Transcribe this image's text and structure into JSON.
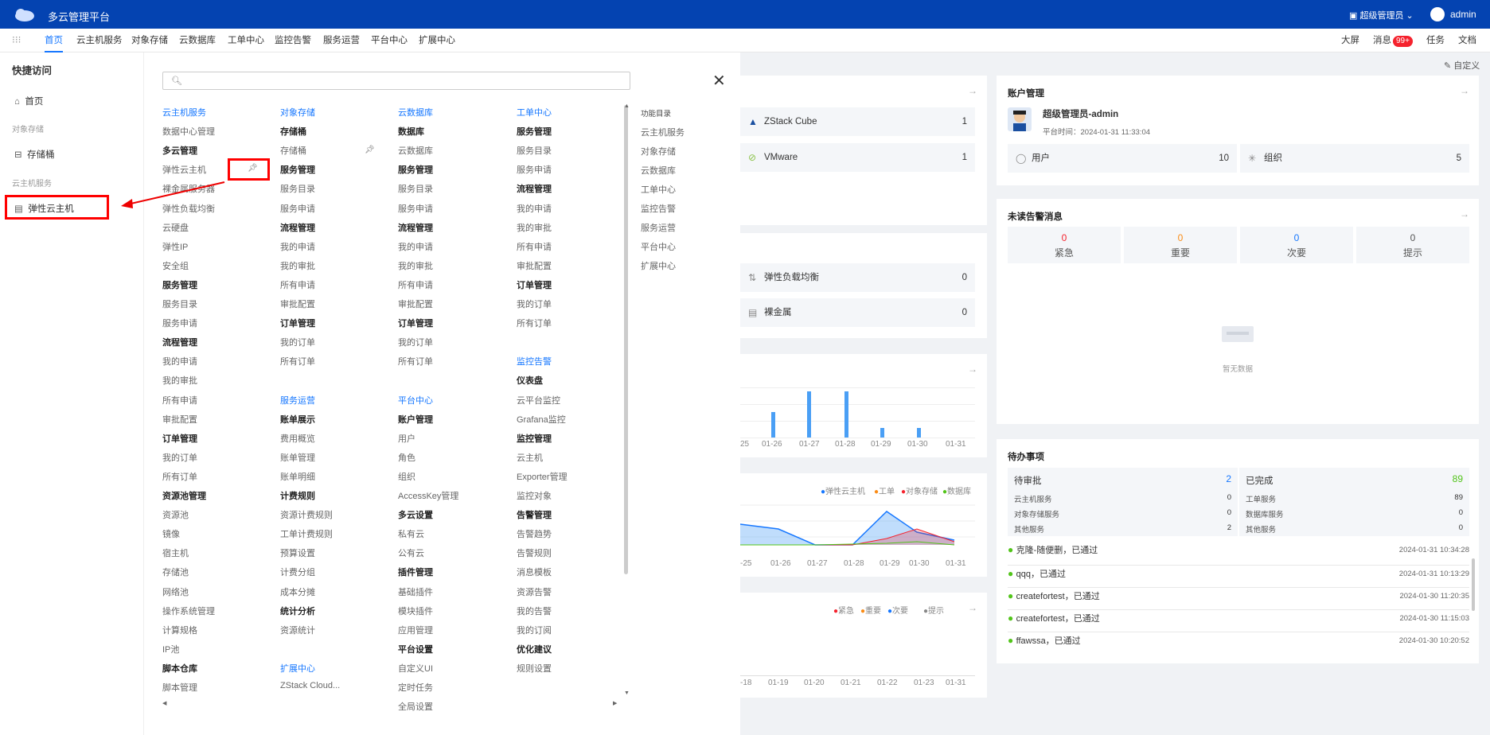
{
  "app": {
    "title": "多云管理平台",
    "role": "超级管理员",
    "user": "admin"
  },
  "nav": {
    "items": [
      "首页",
      "云主机服务",
      "对象存储",
      "云数据库",
      "工单中心",
      "监控告警",
      "服务运营",
      "平台中心",
      "扩展中心"
    ],
    "right": {
      "screen": "大屏",
      "messages": "消息",
      "msg_badge": "99+",
      "tasks": "任务",
      "docs": "文档"
    }
  },
  "customize": "自定义",
  "quick_access": {
    "title": "快捷访问",
    "items": [
      {
        "label": "首页",
        "icon": "home-icon"
      },
      {
        "group": "对象存储"
      },
      {
        "label": "存储桶",
        "icon": "bucket-icon"
      },
      {
        "group": "云主机服务"
      },
      {
        "label": "弹性云主机",
        "icon": "server-icon"
      }
    ]
  },
  "menu": {
    "search_placeholder": "",
    "col1": [
      "云主机服务",
      "数据中心管理",
      "多云管理",
      "弹性云主机",
      "裸金属服务器",
      "弹性负载均衡",
      "云硬盘",
      "弹性IP",
      "安全组",
      "服务管理",
      "服务目录",
      "服务申请",
      "流程管理",
      "我的申请",
      "我的审批",
      "所有申请",
      "审批配置",
      "订单管理",
      "我的订单",
      "所有订单",
      "资源池管理",
      "资源池",
      "镜像",
      "宿主机",
      "存储池",
      "网络池",
      "操作系统管理",
      "计算规格",
      "IP池",
      "脚本仓库",
      "脚本管理"
    ],
    "col2": [
      "对象存储",
      "存储桶",
      "存储桶",
      "服务管理",
      "服务目录",
      "服务申请",
      "流程管理",
      "我的申请",
      "我的审批",
      "所有申请",
      "审批配置",
      "订单管理",
      "我的订单",
      "所有订单",
      "",
      "服务运营",
      "账单展示",
      "费用概览",
      "账单管理",
      "账单明细",
      "计费规则",
      "资源计费规则",
      "工单计费规则",
      "预算设置",
      "计费分组",
      "成本分摊",
      "统计分析",
      "资源统计",
      "",
      "扩展中心",
      "ZStack Cloud..."
    ],
    "col3": [
      "云数据库",
      "数据库",
      "云数据库",
      "服务管理",
      "服务目录",
      "服务申请",
      "流程管理",
      "我的申请",
      "我的审批",
      "所有申请",
      "审批配置",
      "订单管理",
      "我的订单",
      "所有订单",
      "",
      "平台中心",
      "账户管理",
      "用户",
      "角色",
      "组织",
      "AccessKey管理",
      "多云设置",
      "私有云",
      "公有云",
      "插件管理",
      "基础插件",
      "模块插件",
      "应用管理",
      "平台设置",
      "自定义UI",
      "定时任务",
      "全局设置"
    ],
    "col4": [
      "工单中心",
      "服务管理",
      "服务目录",
      "服务申请",
      "流程管理",
      "我的申请",
      "我的审批",
      "所有申请",
      "审批配置",
      "订单管理",
      "我的订单",
      "所有订单",
      "",
      "监控告警",
      "仪表盘",
      "云平台监控",
      "Grafana监控",
      "监控管理",
      "云主机",
      "Exporter管理",
      "监控对象",
      "告警管理",
      "告警趋势",
      "告警规则",
      "消息模板",
      "资源告警",
      "我的告警",
      "我的订阅",
      "优化建议",
      "规则设置"
    ],
    "directory_title": "功能目录",
    "directory": [
      "云主机服务",
      "对象存储",
      "云数据库",
      "工单中心",
      "监控告警",
      "服务运营",
      "平台中心",
      "扩展中心"
    ]
  },
  "dashboard": {
    "platforms": [
      {
        "name": "ZStack Cube",
        "count": "1"
      },
      {
        "name": "VMware",
        "count": "1"
      }
    ],
    "resources": [
      {
        "name": "弹性负载均衡",
        "count": "0"
      },
      {
        "name": "裸金属",
        "count": "0"
      }
    ],
    "bar_chart": {
      "ticks": [
        "25",
        "01-26",
        "01-27",
        "01-28",
        "01-29",
        "01-30",
        "01-31"
      ]
    },
    "line_chart": {
      "legend": [
        "弹性云主机",
        "工单",
        "对象存储",
        "数据库"
      ],
      "ticks": [
        "-25",
        "01-26",
        "01-27",
        "01-28",
        "01-29",
        "01-30",
        "01-31"
      ]
    },
    "alert_chart": {
      "legend": [
        "紧急",
        "重要",
        "次要",
        "提示"
      ],
      "ticks": [
        "-18",
        "01-19",
        "01-20",
        "01-21",
        "01-22",
        "01-23",
        "01-31"
      ]
    },
    "account": {
      "title": "账户管理",
      "name": "超级管理员-admin",
      "time": "平台时间：2024-01-31 11:33:04",
      "users_label": "用户",
      "users": "10",
      "orgs_label": "组织",
      "orgs": "5"
    },
    "alerts": {
      "title": "未读告警消息",
      "levels": [
        {
          "label": "紧急",
          "value": "0",
          "color": "#f5222d"
        },
        {
          "label": "重要",
          "value": "0",
          "color": "#fa8c16"
        },
        {
          "label": "次要",
          "value": "0",
          "color": "#1677ff"
        },
        {
          "label": "提示",
          "value": "0",
          "color": "#555"
        }
      ],
      "empty": "暂无数据"
    },
    "todo": {
      "title": "待办事项",
      "pending_label": "待审批",
      "pending": "2",
      "done_label": "已完成",
      "done": "89",
      "pending_rows": [
        [
          "云主机服务",
          "0"
        ],
        [
          "对象存储服务",
          "0"
        ],
        [
          "其他服务",
          "2"
        ]
      ],
      "done_rows": [
        [
          "工单服务",
          "89"
        ],
        [
          "数据库服务",
          "0"
        ],
        [
          "其他服务",
          "0"
        ]
      ],
      "list": [
        [
          "克隆-随便删，已通过",
          "2024-01-31 10:34:28"
        ],
        [
          "qqq，已通过",
          "2024-01-31 10:13:29"
        ],
        [
          "createfortest，已通过",
          "2024-01-30 11:20:35"
        ],
        [
          "createfortest，已通过",
          "2024-01-30 11:15:03"
        ],
        [
          "ffawssa，已通过",
          "2024-01-30 10:20:52"
        ]
      ]
    }
  }
}
